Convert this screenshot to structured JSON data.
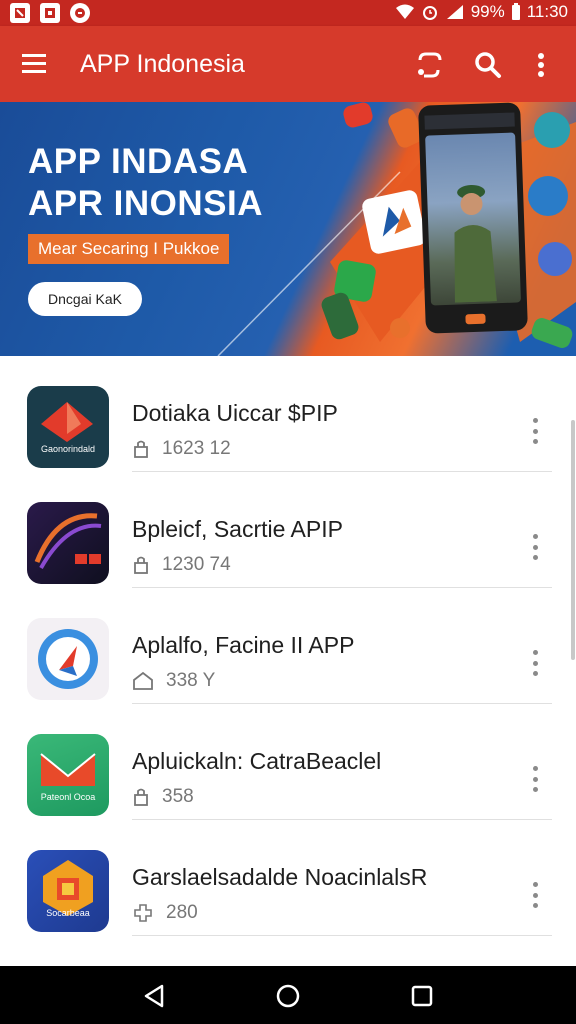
{
  "status_bar": {
    "battery_percent": "99%",
    "time": "11:30"
  },
  "app_bar": {
    "title": "APP Indonesia"
  },
  "banner": {
    "headline_1": "APP INDASA",
    "headline_2": "APR INONSIA",
    "tagline": "Mear Secaring I Pukkoe",
    "button_label": "Dncgai KaK"
  },
  "apps": [
    {
      "title": "Dotiaka Uiccar $PIP",
      "meta": "1623 12",
      "icon_caption": "Gaonorindald",
      "icon_name": "red-arrow-app-icon"
    },
    {
      "title": "Bpleicf, Sacrtie APIP",
      "meta": "1230 74",
      "icon_caption": "",
      "icon_name": "swirl-app-icon"
    },
    {
      "title": "Aplalfo, Facine II APP",
      "meta": "338  Y",
      "icon_caption": "",
      "icon_name": "compass-app-icon"
    },
    {
      "title": "Apluickaln: CatraBeaclel",
      "meta": "358",
      "icon_caption": "Pateonl Ocoa",
      "icon_name": "mail-app-icon"
    },
    {
      "title": "Garslaelsadalde NoacinlalsR",
      "meta": "280",
      "icon_caption": "Socarbeaa",
      "icon_name": "grid-app-icon"
    }
  ],
  "colors": {
    "app_bar": "#d63a2b",
    "status_bar": "#c42820",
    "banner_blue": "#1e5aa8",
    "banner_orange": "#e8702c"
  }
}
